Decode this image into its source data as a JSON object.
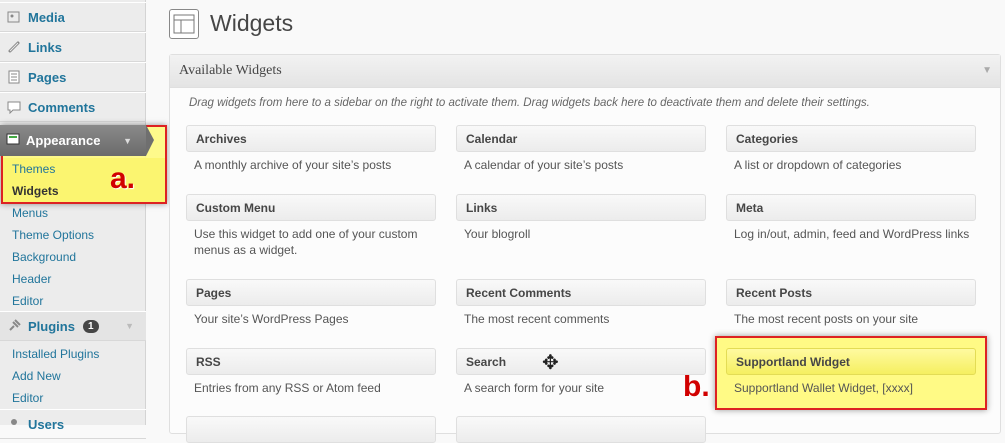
{
  "sidebar": {
    "media": "Media",
    "links": "Links",
    "pages": "Pages",
    "comments": "Comments",
    "appearance": "Appearance",
    "appearance_sub": [
      "Themes",
      "Widgets",
      "Menus",
      "Theme Options",
      "Background",
      "Header",
      "Editor"
    ],
    "plugins": "Plugins",
    "plugins_badge": "1",
    "plugins_sub": [
      "Installed Plugins",
      "Add New",
      "Editor"
    ],
    "users": "Users"
  },
  "annotations": {
    "a": "a.",
    "b": "b."
  },
  "page": {
    "title": "Widgets"
  },
  "panel": {
    "title": "Available Widgets",
    "description": "Drag widgets from here to a sidebar on the right to activate them. Drag widgets back here to deactivate them and delete their settings."
  },
  "widgets": [
    {
      "title": "Archives",
      "desc": "A monthly archive of your site’s posts"
    },
    {
      "title": "Calendar",
      "desc": "A calendar of your site’s posts"
    },
    {
      "title": "Categories",
      "desc": "A list or dropdown of categories"
    },
    {
      "title": "Custom Menu",
      "desc": "Use this widget to add one of your custom menus as a widget."
    },
    {
      "title": "Links",
      "desc": "Your blogroll"
    },
    {
      "title": "Meta",
      "desc": "Log in/out, admin, feed and WordPress links"
    },
    {
      "title": "Pages",
      "desc": "Your site’s WordPress Pages"
    },
    {
      "title": "Recent Comments",
      "desc": "The most recent comments"
    },
    {
      "title": "Recent Posts",
      "desc": "The most recent posts on your site"
    },
    {
      "title": "RSS",
      "desc": "Entries from any RSS or Atom feed"
    },
    {
      "title": "Search",
      "desc": "A search form for your site"
    },
    {
      "title": "Supportland Widget",
      "desc": "Supportland Wallet Widget, [xxxx]"
    }
  ],
  "colors": {
    "link": "#21759b",
    "highlight": "#fbf570",
    "annotation": "#d10000"
  }
}
